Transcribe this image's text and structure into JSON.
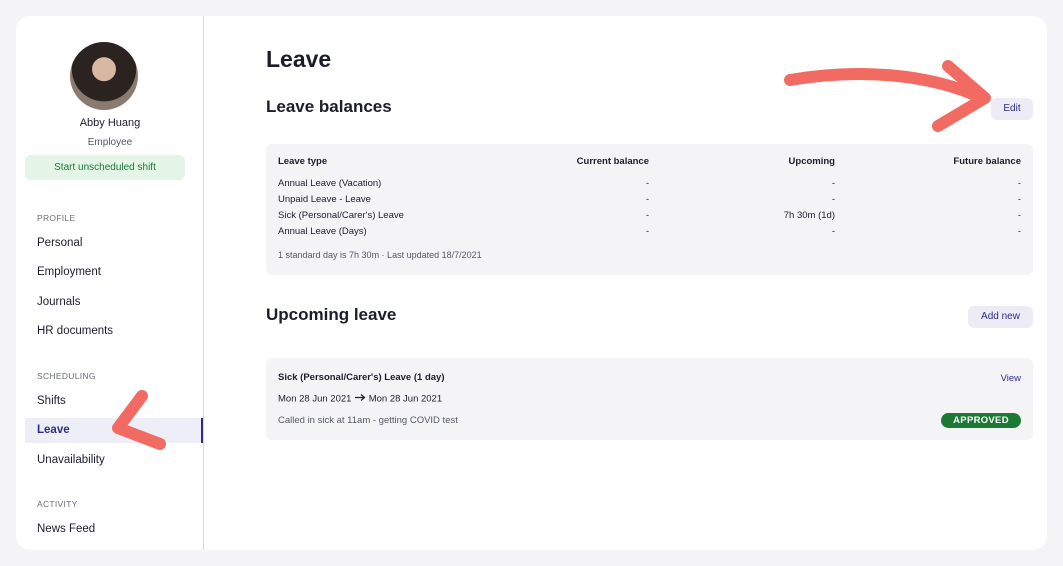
{
  "user": {
    "name": "Abby Huang",
    "role": "Employee",
    "start_shift_label": "Start unscheduled shift"
  },
  "sidebar": {
    "sections": [
      {
        "title": "PROFILE",
        "items": [
          "Personal",
          "Employment",
          "Journals",
          "HR documents"
        ]
      },
      {
        "title": "SCHEDULING",
        "items": [
          "Shifts",
          "Leave",
          "Unavailability"
        ]
      },
      {
        "title": "ACTIVITY",
        "items": [
          "News Feed"
        ]
      }
    ],
    "active_item": "Leave"
  },
  "page": {
    "title": "Leave"
  },
  "balances": {
    "heading": "Leave balances",
    "edit_label": "Edit",
    "columns": [
      "Leave type",
      "Current balance",
      "Upcoming",
      "Future balance"
    ],
    "rows": [
      [
        "Annual Leave (Vacation)",
        "-",
        "-",
        "-"
      ],
      [
        "Unpaid Leave - Leave",
        "-",
        "-",
        "-"
      ],
      [
        "Sick (Personal/Carer's) Leave",
        "-",
        "7h 30m (1d)",
        "-"
      ],
      [
        "Annual Leave (Days)",
        "-",
        "-",
        "-"
      ]
    ],
    "footnote": "1 standard day is 7h 30m · Last updated 18/7/2021"
  },
  "upcoming": {
    "heading": "Upcoming leave",
    "add_label": "Add new",
    "item": {
      "title": "Sick (Personal/Carer's) Leave (1 day)",
      "start": "Mon 28 Jun 2021",
      "end": "Mon 28 Jun 2021",
      "note": "Called in sick at 11am - getting COVID test",
      "view_label": "View",
      "status": "APPROVED"
    }
  },
  "colors": {
    "accent": "#2d2c8c",
    "approved": "#1a7a33",
    "annotation_arrow": "#f26b63"
  }
}
